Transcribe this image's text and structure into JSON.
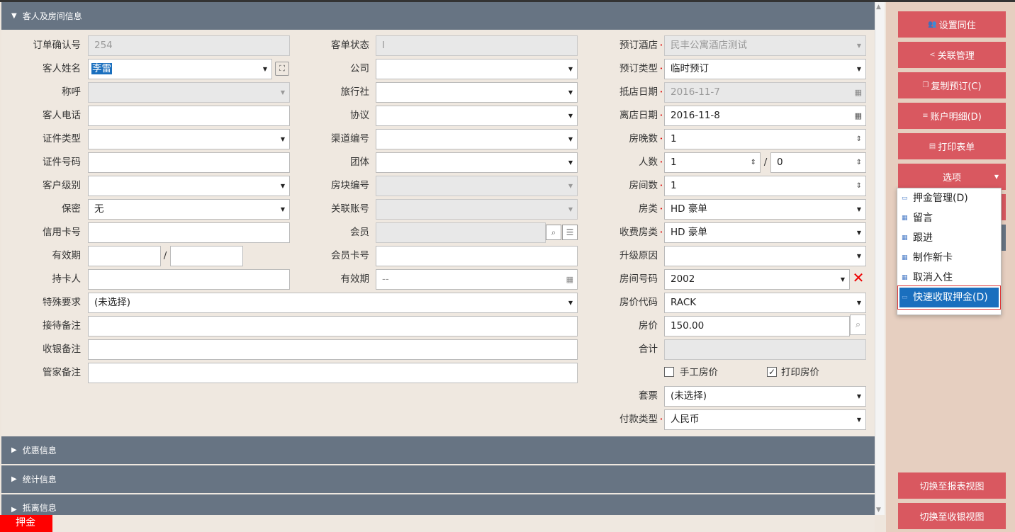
{
  "sections": {
    "guest_room": "客人及房间信息",
    "discount": "优惠信息",
    "stats": "统计信息",
    "departure": "抵离信息"
  },
  "col1": {
    "order_no": {
      "label": "订单确认号",
      "value": "254"
    },
    "guest_name": {
      "label": "客人姓名",
      "value": "李雷"
    },
    "title": {
      "label": "称呼",
      "value": ""
    },
    "phone": {
      "label": "客人电话",
      "value": ""
    },
    "id_type": {
      "label": "证件类型",
      "value": ""
    },
    "id_no": {
      "label": "证件号码",
      "value": ""
    },
    "level": {
      "label": "客户级别",
      "value": ""
    },
    "secret": {
      "label": "保密",
      "value": "无"
    },
    "card_no": {
      "label": "信用卡号",
      "value": ""
    },
    "expiry": {
      "label": "有效期",
      "sep": "/"
    },
    "holder": {
      "label": "持卡人",
      "value": ""
    },
    "special": {
      "label": "特殊要求",
      "value": "(未选择)"
    },
    "reception_note": {
      "label": "接待备注",
      "value": ""
    },
    "cashier_note": {
      "label": "收银备注",
      "value": ""
    },
    "housekeeping_note": {
      "label": "管家备注",
      "value": ""
    }
  },
  "col2": {
    "status": {
      "label": "客单状态",
      "value": "I"
    },
    "company": {
      "label": "公司",
      "value": ""
    },
    "agency": {
      "label": "旅行社",
      "value": ""
    },
    "agreement": {
      "label": "协议",
      "value": ""
    },
    "channel": {
      "label": "渠道编号",
      "value": ""
    },
    "group": {
      "label": "团体",
      "value": ""
    },
    "block": {
      "label": "房块编号",
      "value": ""
    },
    "linked": {
      "label": "关联账号",
      "value": ""
    },
    "member": {
      "label": "会员",
      "value": ""
    },
    "member_card": {
      "label": "会员卡号",
      "value": ""
    },
    "expiry": {
      "label": "有效期",
      "value": "--"
    }
  },
  "col3": {
    "hotel": {
      "label": "预订酒店",
      "value": "民丰公寓酒店测试"
    },
    "booking_type": {
      "label": "预订类型",
      "value": "临时预订"
    },
    "arrival": {
      "label": "抵店日期",
      "value": "2016-11-7"
    },
    "departure": {
      "label": "离店日期",
      "value": "2016-11-8"
    },
    "nights": {
      "label": "房晚数",
      "value": "1"
    },
    "persons": {
      "label": "人数",
      "value": "1",
      "sep": "/",
      "value2": "0"
    },
    "rooms": {
      "label": "房间数",
      "value": "1"
    },
    "room_type": {
      "label": "房类",
      "value": "HD 豪单"
    },
    "charge_type": {
      "label": "收费房类",
      "value": "HD 豪单"
    },
    "upgrade": {
      "label": "升级原因",
      "value": ""
    },
    "room_no": {
      "label": "房间号码",
      "value": "2002"
    },
    "rate_code": {
      "label": "房价代码",
      "value": "RACK"
    },
    "rate": {
      "label": "房价",
      "value": "150.00"
    },
    "total": {
      "label": "合计",
      "value": ""
    },
    "manual_rate": {
      "label": "手工房价",
      "checked": false
    },
    "print_rate": {
      "label": "打印房价",
      "checked": true
    },
    "package": {
      "label": "套票",
      "value": "(未选择)"
    },
    "payment": {
      "label": "付款类型",
      "value": "人民币"
    }
  },
  "sidebar": {
    "set_cohabit": "设置同住",
    "link_mgmt": "关联管理",
    "copy_booking": "复制预订(C)",
    "account_detail": "账户明细(D)",
    "print_form": "打印表单",
    "options": "选项",
    "to_report": "切换至报表视图",
    "to_cashier": "切换至收银视图"
  },
  "options_menu": [
    "押金管理(D)",
    "留言",
    "跟进",
    "制作新卡",
    "取消入住",
    "快速收取押金(D)"
  ],
  "bottom_tab": "押金",
  "colors": {
    "header": "#677483",
    "button": "#d95860",
    "accent": "#1a6fbe",
    "alert": "#ff0000"
  }
}
